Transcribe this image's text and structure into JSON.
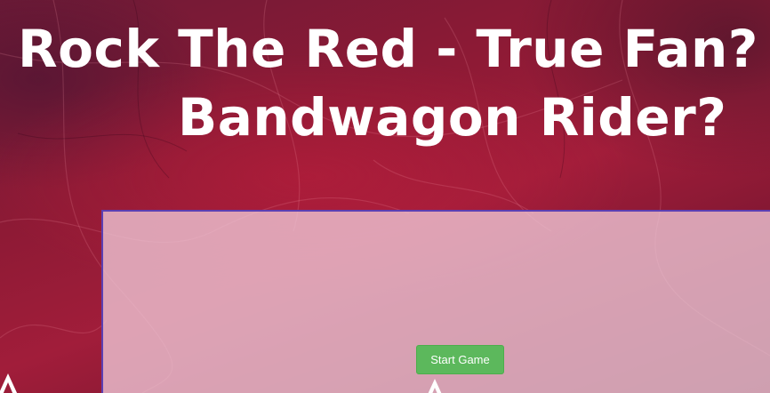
{
  "page": {
    "title_line_1": "Rock The Red - True Fan?",
    "title_line_2": "Bandwagon Rider?"
  },
  "game": {
    "start_button_label": "Start Game"
  },
  "colors": {
    "background": "#8e1a35",
    "title_text": "#ffffff",
    "panel_background": "#f0c8d7",
    "panel_border": "#5b3fb3",
    "start_button": "#5cb85c"
  },
  "icons": {
    "left_marker": "caret-up-icon",
    "center_marker": "caret-up-icon"
  }
}
